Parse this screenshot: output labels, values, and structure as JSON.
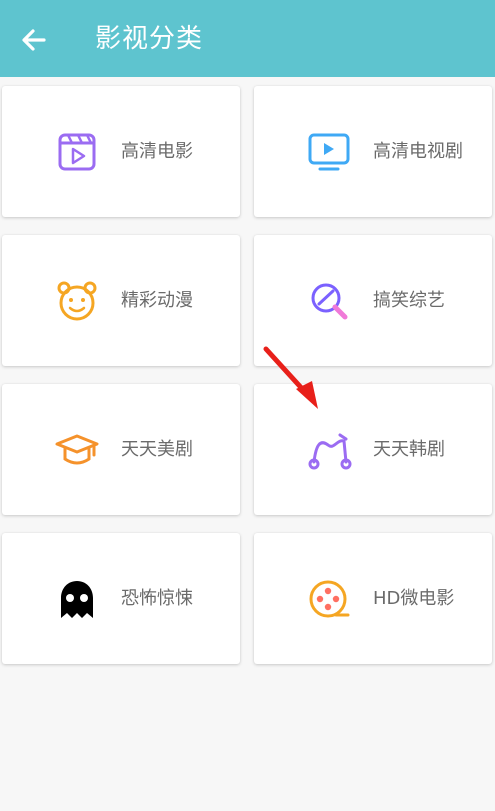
{
  "header": {
    "title": "影视分类",
    "back_icon": "arrow-left-icon",
    "background": "#5ec4cf"
  },
  "categories": [
    {
      "label": "高清电影",
      "icon": "film-clapper-icon",
      "color": "#9b6cf2"
    },
    {
      "label": "高清电视剧",
      "icon": "tv-icon",
      "color": "#3fa9f5"
    },
    {
      "label": "精彩动漫",
      "icon": "bear-face-icon",
      "color": "#f5a623"
    },
    {
      "label": "搞笑综艺",
      "icon": "magnifier-icon",
      "color": "#7b61ff"
    },
    {
      "label": "天天美剧",
      "icon": "graduation-cap-icon",
      "color": "#f5922b"
    },
    {
      "label": "天天韩剧",
      "icon": "music-curve-icon",
      "color": "#9b6cf2"
    },
    {
      "label": "恐怖惊悚",
      "icon": "ghost-icon",
      "color": "#000000"
    },
    {
      "label": "HD微电影",
      "icon": "film-reel-icon",
      "color": "#f5a623"
    }
  ],
  "annotation": {
    "icon": "red-arrow-icon",
    "color": "#e8201a"
  }
}
